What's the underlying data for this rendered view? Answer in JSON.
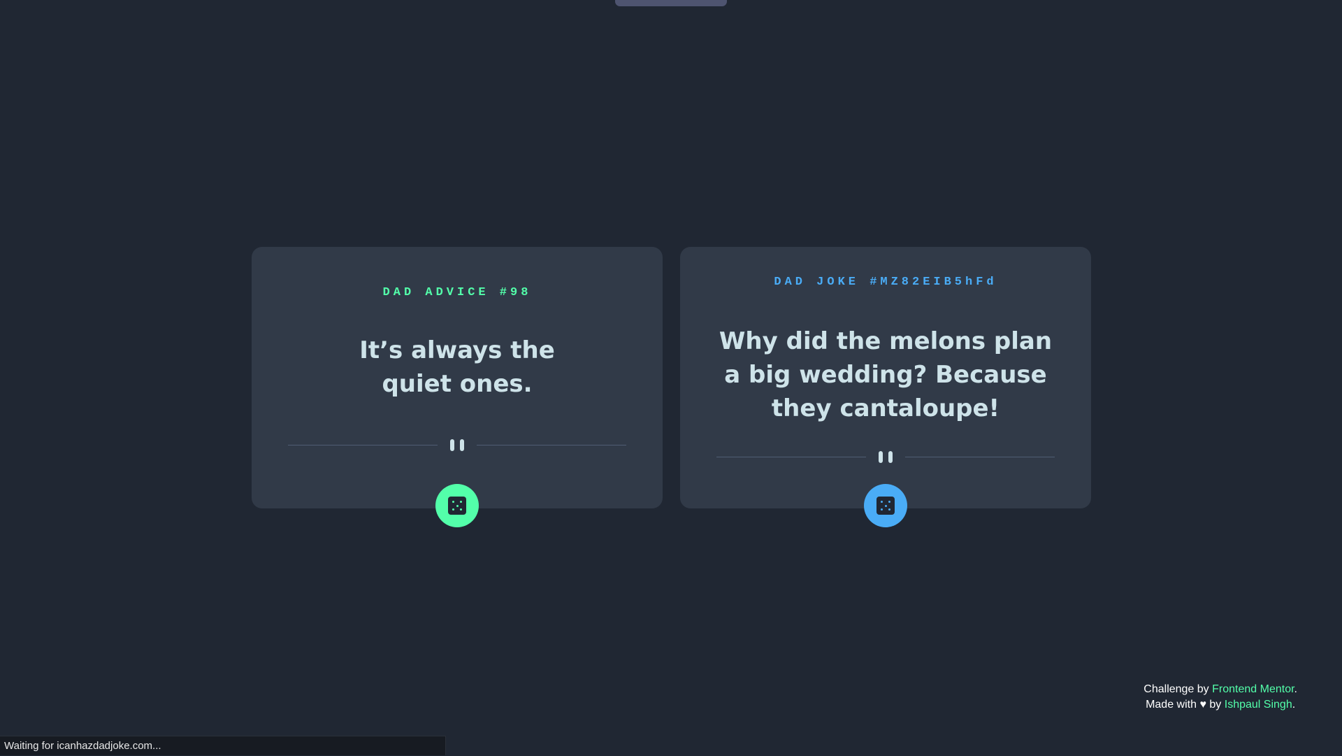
{
  "advice_card": {
    "label": "DAD ADVICE #98",
    "text": "It’s always the quiet ones.",
    "button_icon": "dice-icon",
    "accent_color": "#53ffaa"
  },
  "joke_card": {
    "label": "DAD JOKE #MZ82EIB5hFd",
    "text": "Why did the melons plan a big wedding? Because they cantaloupe!",
    "button_icon": "dice-icon",
    "accent_color": "#4aacf6"
  },
  "attribution": {
    "challenge_prefix": "Challenge by",
    "challenge_link": "Frontend Mentor",
    "challenge_suffix": ".",
    "made_with_prefix": "Made with",
    "heart_icon": "♥",
    "by_text": "by",
    "author_link": "Ishpaul Singh",
    "author_suffix": "."
  },
  "status_bar": {
    "text": "Waiting for icanhazdadjoke.com..."
  },
  "colors": {
    "background": "#202733",
    "card": "#313a48",
    "text": "#cee3e9"
  }
}
